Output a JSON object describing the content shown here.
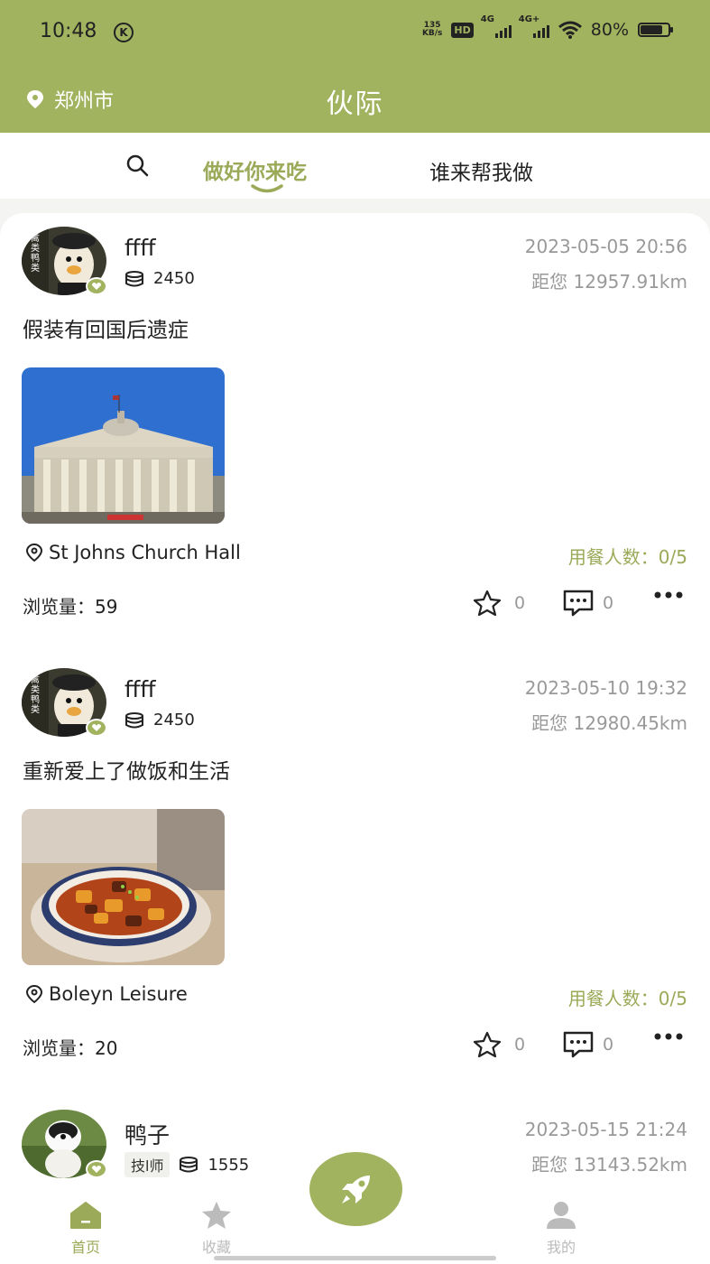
{
  "status_bar": {
    "time": "10:48",
    "net_speed_top": "135",
    "net_speed_bottom": "KB/s",
    "hd_label": "HD",
    "signal1": "4G",
    "signal2": "4G+",
    "battery": "80%",
    "battery_level": 0.8
  },
  "app_bar": {
    "location": "郑州市",
    "title": "伙际"
  },
  "tabs": {
    "active": "做好你来吃",
    "other": "谁来帮我做"
  },
  "posts": [
    {
      "username": "ffff",
      "avatar_text": "禽类鸭类",
      "points": "2450",
      "tag": "",
      "date": "2023-05-05 20:56",
      "distance": "距您 12957.91km",
      "content": "假装有回国后遗症",
      "image": "building-photo",
      "place": "St Johns Church Hall",
      "diners": "用餐人数：0/5",
      "views": "浏览量：59",
      "likes": "0",
      "comments": "0"
    },
    {
      "username": "ffff",
      "avatar_text": "禽类鸭类",
      "points": "2450",
      "tag": "",
      "date": "2023-05-10 19:32",
      "distance": "距您 12980.45km",
      "content": "重新爱上了做饭和生活",
      "image": "food-photo",
      "place": "Boleyn Leisure",
      "diners": "用餐人数：0/5",
      "views": "浏览量：20",
      "likes": "0",
      "comments": "0"
    },
    {
      "username": "鸭子",
      "points": "1555",
      "tag": "技l师",
      "date": "2023-05-15 21:24",
      "distance": "距您 13143.52km"
    }
  ],
  "nav": {
    "home": "首页",
    "favorites": "收藏",
    "profile": "我的"
  },
  "colors": {
    "brand": "#a2b360",
    "accent_text": "#9aaa58",
    "muted": "#999999"
  },
  "icons": [
    "location-pin-icon",
    "search-icon",
    "coins-icon",
    "star-icon",
    "comment-icon",
    "more-icon",
    "home-icon",
    "rocket-icon",
    "user-icon"
  ]
}
